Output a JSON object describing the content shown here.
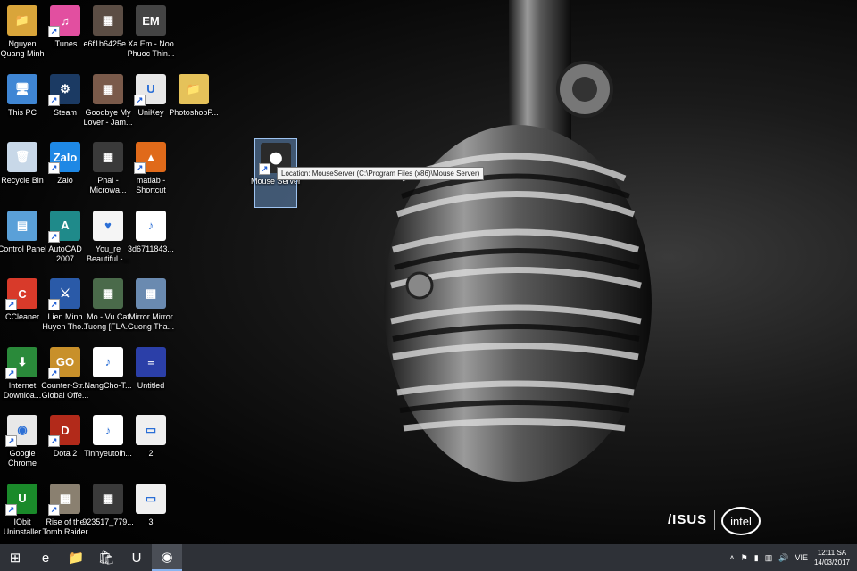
{
  "desktop": {
    "icons": [
      {
        "label": "Nguyen\nQuang Minh",
        "icon": "user-folder-icon",
        "bg": "#d9a53a",
        "glyph": "📁",
        "shortcut": false
      },
      {
        "label": "iTunes",
        "icon": "itunes-icon",
        "bg": "#e24fa0",
        "glyph": "♫",
        "shortcut": true
      },
      {
        "label": "e6f1b6425e...",
        "icon": "image-file-icon",
        "bg": "#5b4d44",
        "glyph": "▦",
        "shortcut": false
      },
      {
        "label": "Xa Em - Noo\nPhuoc Thin...",
        "icon": "music-video-icon",
        "bg": "#444",
        "glyph": "EM",
        "shortcut": false
      },
      {
        "label": "This PC",
        "icon": "computer-icon",
        "bg": "#3f86d4",
        "glyph": "🖥",
        "shortcut": false
      },
      {
        "label": "Steam",
        "icon": "steam-icon",
        "bg": "#1b3a63",
        "glyph": "⚙",
        "shortcut": true
      },
      {
        "label": "Goodbye My\nLover - Jam...",
        "icon": "album-art-icon",
        "bg": "#7a5a4a",
        "glyph": "▦",
        "shortcut": false
      },
      {
        "label": "UniKey",
        "icon": "unikey-icon",
        "bg": "#e8e8e8",
        "glyph": "U",
        "shortcut": true
      },
      {
        "label": "PhotoshopP...",
        "icon": "folder-icon",
        "bg": "#e5c25a",
        "glyph": "📁",
        "shortcut": false
      },
      {
        "label": "Recycle Bin",
        "icon": "recycle-bin-icon",
        "bg": "#c8d8e8",
        "glyph": "🗑",
        "shortcut": false
      },
      {
        "label": "Zalo",
        "icon": "zalo-icon",
        "bg": "#1e88e5",
        "glyph": "Zalo",
        "shortcut": true
      },
      {
        "label": "Phai -\nMicrowa...",
        "icon": "video-file-icon",
        "bg": "#3a3a3a",
        "glyph": "▦",
        "shortcut": false
      },
      {
        "label": "matlab -\nShortcut",
        "icon": "matlab-icon",
        "bg": "#e06a1a",
        "glyph": "▲",
        "shortcut": true
      },
      {
        "label": "Control Panel",
        "icon": "control-panel-icon",
        "bg": "#5aa0d8",
        "glyph": "▤",
        "shortcut": false
      },
      {
        "label": "AutoCAD\n2007",
        "icon": "autocad-icon",
        "bg": "#1f8a8a",
        "glyph": "A",
        "shortcut": true
      },
      {
        "label": "You_re\nBeautiful -...",
        "icon": "love-stories-icon",
        "bg": "#f5f5f5",
        "glyph": "♥",
        "shortcut": false
      },
      {
        "label": "3d6711843...",
        "icon": "mp3-file-icon",
        "bg": "#ffffff",
        "glyph": "♪",
        "shortcut": false
      },
      {
        "label": "CCleaner",
        "icon": "ccleaner-icon",
        "bg": "#d83a2a",
        "glyph": "C",
        "shortcut": true
      },
      {
        "label": "Lien Minh\nHuyen Tho...",
        "icon": "league-icon",
        "bg": "#2a5aa8",
        "glyph": "⚔",
        "shortcut": true
      },
      {
        "label": "Mo - Vu Cat\nTuong [FLA...",
        "icon": "video-file-icon",
        "bg": "#4a6a4a",
        "glyph": "▦",
        "shortcut": false
      },
      {
        "label": "Mirror Mirror\nGuong Tha...",
        "icon": "video-file-icon",
        "bg": "#6a8ab0",
        "glyph": "▦",
        "shortcut": false
      },
      {
        "label": "Internet\nDownloa...",
        "icon": "idm-icon",
        "bg": "#2a8a3a",
        "glyph": "⬇",
        "shortcut": true
      },
      {
        "label": "Counter-Str...\nGlobal Offe...",
        "icon": "csgo-icon",
        "bg": "#c8902a",
        "glyph": "GO",
        "shortcut": true
      },
      {
        "label": "NangCho-T...",
        "icon": "mp3-file-icon",
        "bg": "#ffffff",
        "glyph": "♪",
        "shortcut": false
      },
      {
        "label": "Untitled",
        "icon": "document-icon",
        "bg": "#2b3fa8",
        "glyph": "≡",
        "shortcut": false
      },
      {
        "label": "Google\nChrome",
        "icon": "chrome-icon",
        "bg": "#e8e8e8",
        "glyph": "◉",
        "shortcut": true
      },
      {
        "label": "Dota 2",
        "icon": "dota-icon",
        "bg": "#b22a1a",
        "glyph": "D",
        "shortcut": true
      },
      {
        "label": "Tinhyeutoih...",
        "icon": "mp3-file-icon",
        "bg": "#ffffff",
        "glyph": "♪",
        "shortcut": false
      },
      {
        "label": "2",
        "icon": "blank-file-icon",
        "bg": "#f0f0f0",
        "glyph": "▭",
        "shortcut": false
      },
      {
        "label": "IObit\nUninstaller",
        "icon": "iobit-icon",
        "bg": "#1a8a2a",
        "glyph": "U",
        "shortcut": true
      },
      {
        "label": "Rise of the\nTomb Raider",
        "icon": "tomb-raider-icon",
        "bg": "#8a8070",
        "glyph": "▦",
        "shortcut": true
      },
      {
        "label": "923517_779...",
        "icon": "image-file-icon",
        "bg": "#3a3a3a",
        "glyph": "▦",
        "shortcut": false
      },
      {
        "label": "3",
        "icon": "blank-file-icon",
        "bg": "#f0f0f0",
        "glyph": "▭",
        "shortcut": false
      },
      {
        "label": "Mouse Server",
        "icon": "mouse-server-icon",
        "bg": "#2a2a2a",
        "glyph": "⬤",
        "shortcut": true
      }
    ],
    "tooltip": "Location: MouseServer (C:\\Program Files (x86)\\Mouse Server)",
    "brand": {
      "asus": "/ISUS",
      "intel": "intel"
    }
  },
  "taskbar": {
    "buttons": [
      {
        "name": "start-button",
        "icon": "windows-logo-icon",
        "glyph": "⊞",
        "active": false
      },
      {
        "name": "internet-explorer-button",
        "icon": "internet-explorer-icon",
        "glyph": "e",
        "active": false
      },
      {
        "name": "file-explorer-button",
        "icon": "folder-icon",
        "glyph": "📁",
        "active": false
      },
      {
        "name": "store-button",
        "icon": "store-icon",
        "glyph": "🛍",
        "active": false
      },
      {
        "name": "unikey-button",
        "icon": "unikey-icon",
        "glyph": "U",
        "active": false
      },
      {
        "name": "chrome-button",
        "icon": "chrome-icon",
        "glyph": "◉",
        "active": true
      }
    ],
    "tray": {
      "language": "VIE",
      "time": "12:11 SA",
      "date": "14/03/2017"
    }
  }
}
